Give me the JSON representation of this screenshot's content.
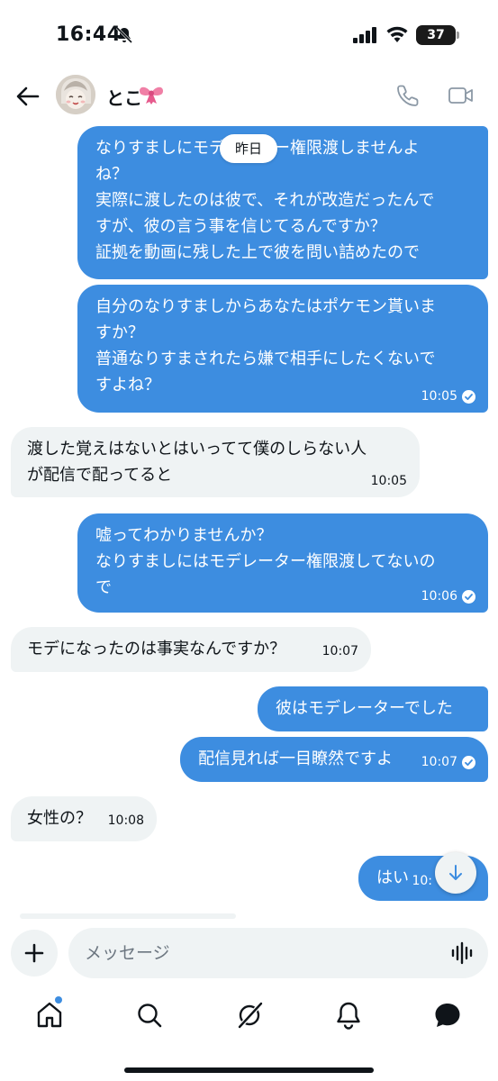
{
  "status_bar": {
    "time": "16:44",
    "battery": "37"
  },
  "header": {
    "contact_name": "とこ"
  },
  "date_pill": "昨日",
  "messages": [
    {
      "lines": [
        "なりすましにモデレーター権限渡しませんよ",
        "ね？",
        "実際に渡したのは彼で、それが改造だったんで",
        "すが、彼の言う事を信じてるんですか？",
        "証拠を動画に残した上で彼を問い詰めたので"
      ]
    },
    {
      "lines": [
        "自分のなりすましからあなたはポケモン貰いま",
        "すか？",
        "普通なりすまされたら嫌で相手にしたくないで",
        "すよね？"
      ],
      "time": "10:05"
    },
    {
      "lines": [
        "渡した覚えはないとはいってて僕のしらない人",
        "が配信で配ってると"
      ],
      "time": "10:05"
    },
    {
      "lines": [
        "嘘ってわかりませんか？",
        "なりすましにはモデレーター権限渡してないの",
        "で"
      ],
      "time": "10:06"
    },
    {
      "lines": [
        "モデになったのは事実なんですか？"
      ],
      "time": "10:07"
    },
    {
      "lines": [
        "彼はモデレーターでした"
      ]
    },
    {
      "lines": [
        "配信見れば一目瞭然ですよ"
      ],
      "time": "10:07"
    },
    {
      "lines": [
        "女性の？"
      ],
      "time": "10:08"
    },
    {
      "lines": [
        "はい"
      ],
      "time": "10:"
    }
  ],
  "composer": {
    "placeholder": "メッセージ"
  },
  "colors": {
    "outgoing_bubble": "#3d8de0",
    "incoming_bubble": "#eff3f4",
    "accent": "#3d8de0"
  },
  "icons": [
    "bell-off-icon",
    "signal-icon",
    "wifi-icon",
    "back-arrow-icon",
    "bow-icon",
    "phone-icon",
    "video-camera-icon",
    "read-check-icon",
    "arrow-down-icon",
    "plus-icon",
    "voice-wave-icon",
    "home-icon",
    "search-icon",
    "grok-icon",
    "bell-icon",
    "messages-icon"
  ]
}
